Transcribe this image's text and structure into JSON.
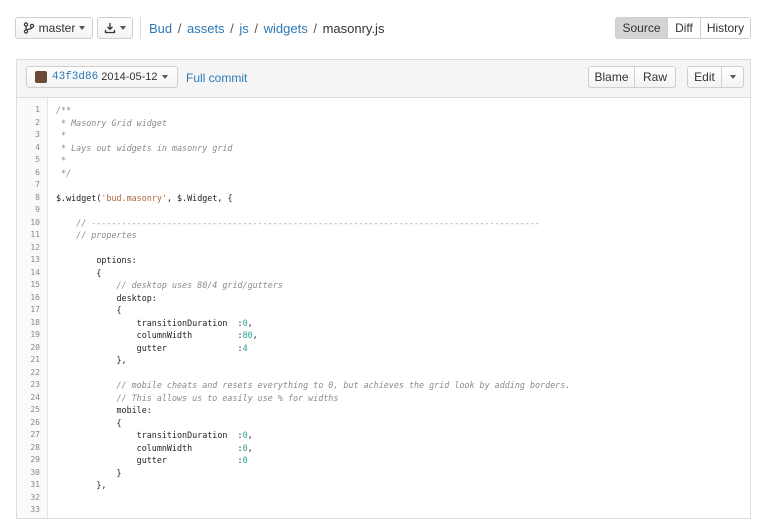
{
  "toolbar": {
    "branch_label": "master",
    "breadcrumb": [
      {
        "label": "Bud"
      },
      {
        "label": "assets"
      },
      {
        "label": "js"
      },
      {
        "label": "widgets"
      }
    ],
    "current_file": "masonry.js",
    "views": {
      "source": "Source",
      "diff": "Diff",
      "history": "History"
    }
  },
  "file_header": {
    "commit_sha": "43f3d86",
    "commit_date": "2014-05-12",
    "full_commit": "Full commit",
    "blame": "Blame",
    "raw": "Raw",
    "edit": "Edit"
  },
  "code": {
    "lines": [
      {
        "n": "1",
        "parts": [
          {
            "t": "/**",
            "k": "comment"
          }
        ]
      },
      {
        "n": "2",
        "parts": [
          {
            "t": " * Masonry Grid widget",
            "k": "comment"
          }
        ]
      },
      {
        "n": "3",
        "parts": [
          {
            "t": " *",
            "k": "comment"
          }
        ]
      },
      {
        "n": "4",
        "parts": [
          {
            "t": " * Lays out widgets in masonry grid",
            "k": "comment"
          }
        ]
      },
      {
        "n": "5",
        "parts": [
          {
            "t": " *",
            "k": "comment"
          }
        ]
      },
      {
        "n": "6",
        "parts": [
          {
            "t": " */",
            "k": "comment"
          }
        ]
      },
      {
        "n": "7",
        "parts": []
      },
      {
        "n": "8",
        "parts": [
          {
            "t": "$.widget(",
            "k": "plain"
          },
          {
            "t": "'bud.masonry'",
            "k": "string"
          },
          {
            "t": ", $.Widget, {",
            "k": "plain"
          }
        ]
      },
      {
        "n": "9",
        "parts": []
      },
      {
        "n": "10",
        "parts": [
          {
            "t": "    // -----------------------------------------------------------------------------------------",
            "k": "comment"
          }
        ]
      },
      {
        "n": "11",
        "parts": [
          {
            "t": "    // propertes",
            "k": "comment"
          }
        ]
      },
      {
        "n": "12",
        "parts": []
      },
      {
        "n": "13",
        "parts": [
          {
            "t": "        options:",
            "k": "plain"
          }
        ]
      },
      {
        "n": "14",
        "parts": [
          {
            "t": "        {",
            "k": "plain"
          }
        ]
      },
      {
        "n": "15",
        "parts": [
          {
            "t": "            // desktop uses 80/4 grid/gutters",
            "k": "comment"
          }
        ]
      },
      {
        "n": "16",
        "parts": [
          {
            "t": "            desktop:",
            "k": "plain"
          }
        ]
      },
      {
        "n": "17",
        "parts": [
          {
            "t": "            {",
            "k": "plain"
          }
        ]
      },
      {
        "n": "18",
        "parts": [
          {
            "t": "                transitionDuration  :",
            "k": "plain"
          },
          {
            "t": "0",
            "k": "number"
          },
          {
            "t": ",",
            "k": "plain"
          }
        ]
      },
      {
        "n": "19",
        "parts": [
          {
            "t": "                columnWidth         :",
            "k": "plain"
          },
          {
            "t": "80",
            "k": "number"
          },
          {
            "t": ",",
            "k": "plain"
          }
        ]
      },
      {
        "n": "20",
        "parts": [
          {
            "t": "                gutter              :",
            "k": "plain"
          },
          {
            "t": "4",
            "k": "number"
          }
        ]
      },
      {
        "n": "21",
        "parts": [
          {
            "t": "            },",
            "k": "plain"
          }
        ]
      },
      {
        "n": "22",
        "parts": []
      },
      {
        "n": "23",
        "parts": [
          {
            "t": "            // mobile cheats and resets everything to 0, but achieves the grid look by adding borders.",
            "k": "comment"
          }
        ]
      },
      {
        "n": "24",
        "parts": [
          {
            "t": "            // This allows us to easily use % for widths",
            "k": "comment"
          }
        ]
      },
      {
        "n": "25",
        "parts": [
          {
            "t": "            mobile:",
            "k": "plain"
          }
        ]
      },
      {
        "n": "26",
        "parts": [
          {
            "t": "            {",
            "k": "plain"
          }
        ]
      },
      {
        "n": "27",
        "parts": [
          {
            "t": "                transitionDuration  :",
            "k": "plain"
          },
          {
            "t": "0",
            "k": "number"
          },
          {
            "t": ",",
            "k": "plain"
          }
        ]
      },
      {
        "n": "28",
        "parts": [
          {
            "t": "                columnWidth         :",
            "k": "plain"
          },
          {
            "t": "0",
            "k": "number"
          },
          {
            "t": ",",
            "k": "plain"
          }
        ]
      },
      {
        "n": "29",
        "parts": [
          {
            "t": "                gutter              :",
            "k": "plain"
          },
          {
            "t": "0",
            "k": "number"
          }
        ]
      },
      {
        "n": "30",
        "parts": [
          {
            "t": "            }",
            "k": "plain"
          }
        ]
      },
      {
        "n": "31",
        "parts": [
          {
            "t": "        },",
            "k": "plain"
          }
        ]
      },
      {
        "n": "32",
        "parts": []
      },
      {
        "n": "33",
        "parts": []
      }
    ]
  }
}
